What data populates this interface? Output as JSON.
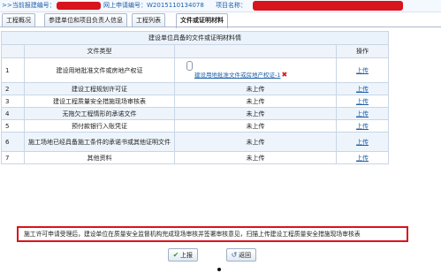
{
  "topbar": {
    "current_project_label": ">>当前报建编号：",
    "online_label": "网上申请编号：W2015110134078",
    "project_name_label": "项目名称："
  },
  "tabs": [
    {
      "label": "工程概况",
      "active": false
    },
    {
      "label": "参建单位和项目负责人信息",
      "active": false
    },
    {
      "label": "工程列表",
      "active": false
    },
    {
      "label": "文件或证明材料",
      "active": true
    }
  ],
  "table": {
    "title": "建设单位具备的文件或证明材料情",
    "col_type": "文件类型",
    "col_op": "操作",
    "rows": [
      {
        "idx": "1",
        "type": "建设用地批准文件或房地产权证",
        "file": "建设用地批准文件或房地产权证-1",
        "op": "上传"
      },
      {
        "idx": "2",
        "type": "建设工程规划许可证",
        "status": "未上传",
        "op": "上传"
      },
      {
        "idx": "3",
        "type": "建设工程质量安全措施现场审核表",
        "status": "未上传",
        "op": "上传"
      },
      {
        "idx": "4",
        "type": "无拖欠工程情形的承诺文件",
        "status": "未上传",
        "op": "上传"
      },
      {
        "idx": "5",
        "type": "预付款银行入账凭证",
        "status": "未上传",
        "op": "上传"
      },
      {
        "idx": "6",
        "type": "施工场地已经具备施工条件的承诺书或其他证明文件",
        "status": "未上传",
        "op": "上传"
      },
      {
        "idx": "7",
        "type": "其他资料",
        "status": "未上传",
        "op": "上传"
      }
    ]
  },
  "notice": "施工许可申请受理后，建设单位在质量安全监督机构完成现场审核并签署审核意见，扫描上传建设工程质量安全措施现场审核表",
  "buttons": {
    "submit": "上报",
    "back": "返回"
  },
  "colors": {
    "accent": "#1f5fa8",
    "alert": "#d8141d"
  }
}
